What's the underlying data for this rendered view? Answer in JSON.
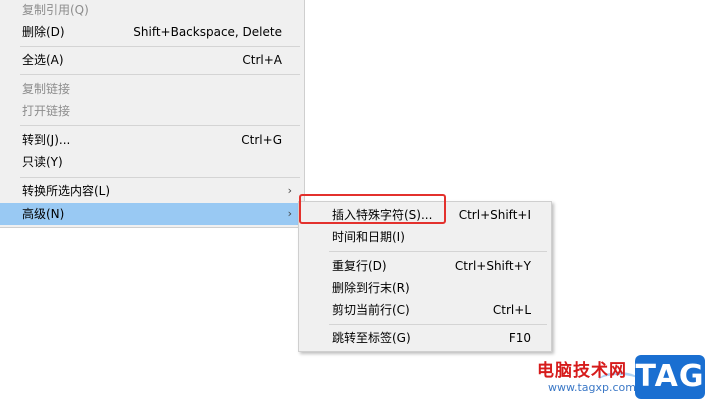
{
  "main_menu": {
    "items": [
      {
        "label": "复制引用(Q)",
        "shortcut": "",
        "disabled": true
      },
      {
        "label": "删除(D)",
        "shortcut": "Shift+Backspace, Delete"
      },
      {
        "label": "全选(A)",
        "shortcut": "Ctrl+A"
      },
      {
        "label": "复制链接",
        "shortcut": "",
        "disabled": true
      },
      {
        "label": "打开链接",
        "shortcut": "",
        "disabled": true
      },
      {
        "label": "转到(J)...",
        "shortcut": "Ctrl+G"
      },
      {
        "label": "只读(Y)",
        "shortcut": ""
      },
      {
        "label": "转换所选内容(L)",
        "shortcut": "",
        "submenu": true
      },
      {
        "label": "高级(N)",
        "shortcut": "",
        "submenu": true,
        "highlighted": true
      }
    ]
  },
  "sub_menu": {
    "items": [
      {
        "label": "插入特殊字符(S)...",
        "shortcut": "Ctrl+Shift+I"
      },
      {
        "label": "时间和日期(I)",
        "shortcut": ""
      },
      {
        "label": "重复行(D)",
        "shortcut": "Ctrl+Shift+Y"
      },
      {
        "label": "删除到行末(R)",
        "shortcut": ""
      },
      {
        "label": "剪切当前行(C)",
        "shortcut": "Ctrl+L"
      },
      {
        "label": "跳转至标签(G)",
        "shortcut": "F10"
      }
    ]
  },
  "watermark": {
    "site_name": "电脑技术网",
    "url": "www.tagxp.com",
    "logo": "TAG"
  },
  "colors": {
    "menu_bg": "#f0f0f0",
    "highlight": "#99c9f3",
    "annotation_box": "#e3312d",
    "disabled_text": "#8d8d8d"
  },
  "icons": [
    "chevron-right-icon"
  ]
}
